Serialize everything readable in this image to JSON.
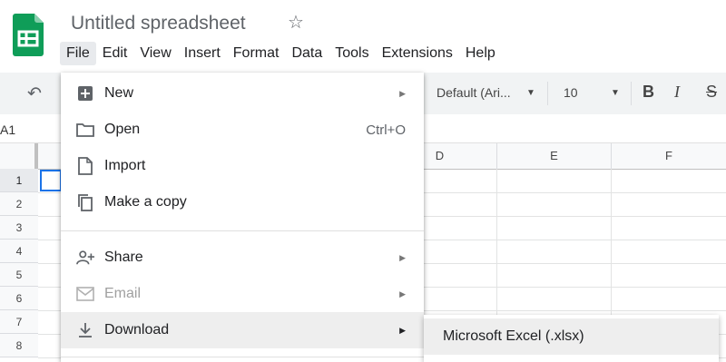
{
  "app": {
    "title": "Untitled spreadsheet"
  },
  "menubar": [
    "File",
    "Edit",
    "View",
    "Insert",
    "Format",
    "Data",
    "Tools",
    "Extensions",
    "Help"
  ],
  "toolbar": {
    "font": "Default (Ari...",
    "font_size": "10",
    "bold": "B",
    "italic": "I",
    "strike": "S"
  },
  "formula_bar": {
    "cell_ref": "A1"
  },
  "grid": {
    "columns": [
      "D",
      "E",
      "F"
    ],
    "rows": [
      "1",
      "2",
      "3",
      "4",
      "5",
      "6",
      "7",
      "8"
    ],
    "selected_cell": "A1"
  },
  "file_menu": {
    "items": [
      {
        "label": "New",
        "icon": "new-sheet-icon",
        "has_submenu": true
      },
      {
        "label": "Open",
        "icon": "folder-icon",
        "shortcut": "Ctrl+O"
      },
      {
        "label": "Import",
        "icon": "file-icon"
      },
      {
        "label": "Make a copy",
        "icon": "copy-icon"
      },
      {
        "label": "Share",
        "icon": "share-person-icon",
        "has_submenu": true
      },
      {
        "label": "Email",
        "icon": "email-icon",
        "has_submenu": true,
        "disabled": true
      },
      {
        "label": "Download",
        "icon": "download-icon",
        "has_submenu": true,
        "highlighted": true
      }
    ]
  },
  "download_submenu": {
    "items": [
      {
        "label": "Microsoft Excel (.xlsx)"
      }
    ]
  },
  "colors": {
    "sheets_green": "#0f9d58",
    "selection_blue": "#1a73e8",
    "menu_hover": "#eeeeee"
  }
}
